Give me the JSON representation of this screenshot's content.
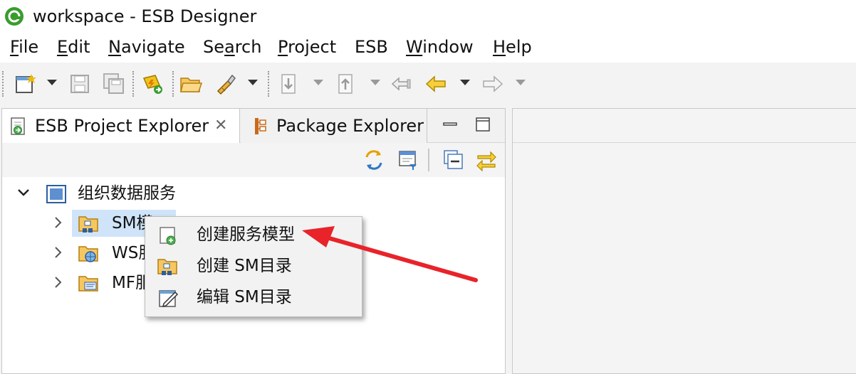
{
  "window": {
    "title": "workspace - ESB Designer"
  },
  "menubar": {
    "items": [
      {
        "label": "File",
        "mnemonic": "F",
        "rest": "ile"
      },
      {
        "label": "Edit",
        "mnemonic": "E",
        "rest": "dit"
      },
      {
        "label": "Navigate",
        "mnemonic": "N",
        "rest": "avigate"
      },
      {
        "label": "Search",
        "pre": "Se",
        "mnemonic": "a",
        "rest": "rch"
      },
      {
        "label": "Project",
        "mnemonic": "P",
        "rest": "roject"
      },
      {
        "label": "ESB",
        "plain": "ESB"
      },
      {
        "label": "Window",
        "mnemonic": "W",
        "rest": "indow"
      },
      {
        "label": "Help",
        "mnemonic": "H",
        "rest": "elp"
      }
    ]
  },
  "toolbar": {
    "icons": [
      "new-wizard-icon",
      "save-icon",
      "save-all-icon",
      "deploy-icon",
      "open-folder-icon",
      "tool-icon",
      "next-annotation-icon",
      "previous-annotation-icon",
      "last-edit-icon",
      "back-icon",
      "forward-icon"
    ]
  },
  "left_panel": {
    "tabs": [
      {
        "label": "ESB Project Explorer",
        "active": true,
        "close": "✕"
      },
      {
        "label": "Package Explorer",
        "active": false
      }
    ],
    "view_toolbar_icons": [
      "sync-icon",
      "filter-icon",
      "collapse-all-icon",
      "link-with-editor-icon"
    ],
    "tree": {
      "root": {
        "label": "组织数据服务",
        "expanded": true
      },
      "children": [
        {
          "label": "SM模型",
          "visible_label": "SM模",
          "selected": true
        },
        {
          "label": "WS服",
          "visible_label": "WS服"
        },
        {
          "label": "MF服",
          "visible_label": "MF服"
        }
      ]
    }
  },
  "context_menu": {
    "items": [
      {
        "label": "创建服务模型",
        "icon": "create-model-icon"
      },
      {
        "label": "创建 SM目录",
        "icon": "create-folder-icon"
      },
      {
        "label": "编辑 SM目录",
        "icon": "edit-icon"
      }
    ]
  },
  "colors": {
    "selection": "#cfe4f8",
    "annotation_arrow": "#e8232a",
    "toolbar_bg": "#f3f3f3"
  }
}
